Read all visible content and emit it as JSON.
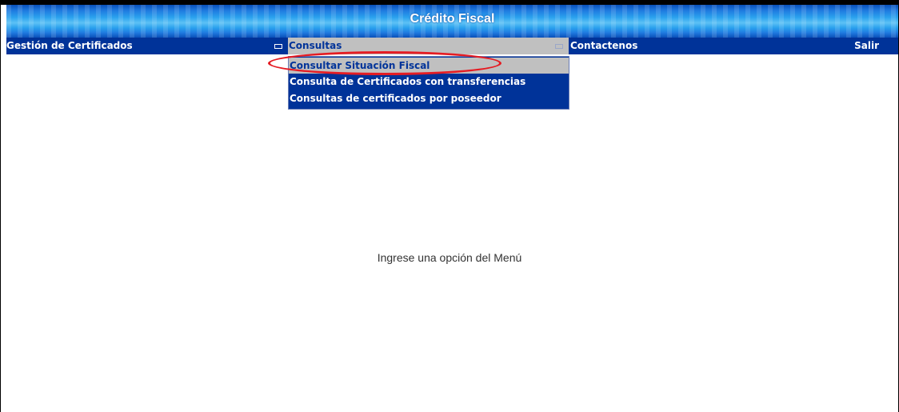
{
  "window": {
    "title": "Crédito Fiscal"
  },
  "menu": {
    "gestion": "Gestión de Certificados",
    "consultas": "Consultas",
    "contactenos": "Contactenos",
    "salir": "Salir"
  },
  "dropdown": {
    "items": [
      "Consultar Situación Fiscal",
      "Consulta de Certificados con transferencias",
      "Consultas de certificados por poseedor"
    ],
    "selected_index": 0
  },
  "main": {
    "message": "Ingrese una opción del Menú"
  },
  "colors": {
    "menubar": "#003399",
    "menu_selected_bg": "#c0c0c0",
    "highlight": "#e51c23",
    "title_gradient": "#2aa1ee"
  }
}
